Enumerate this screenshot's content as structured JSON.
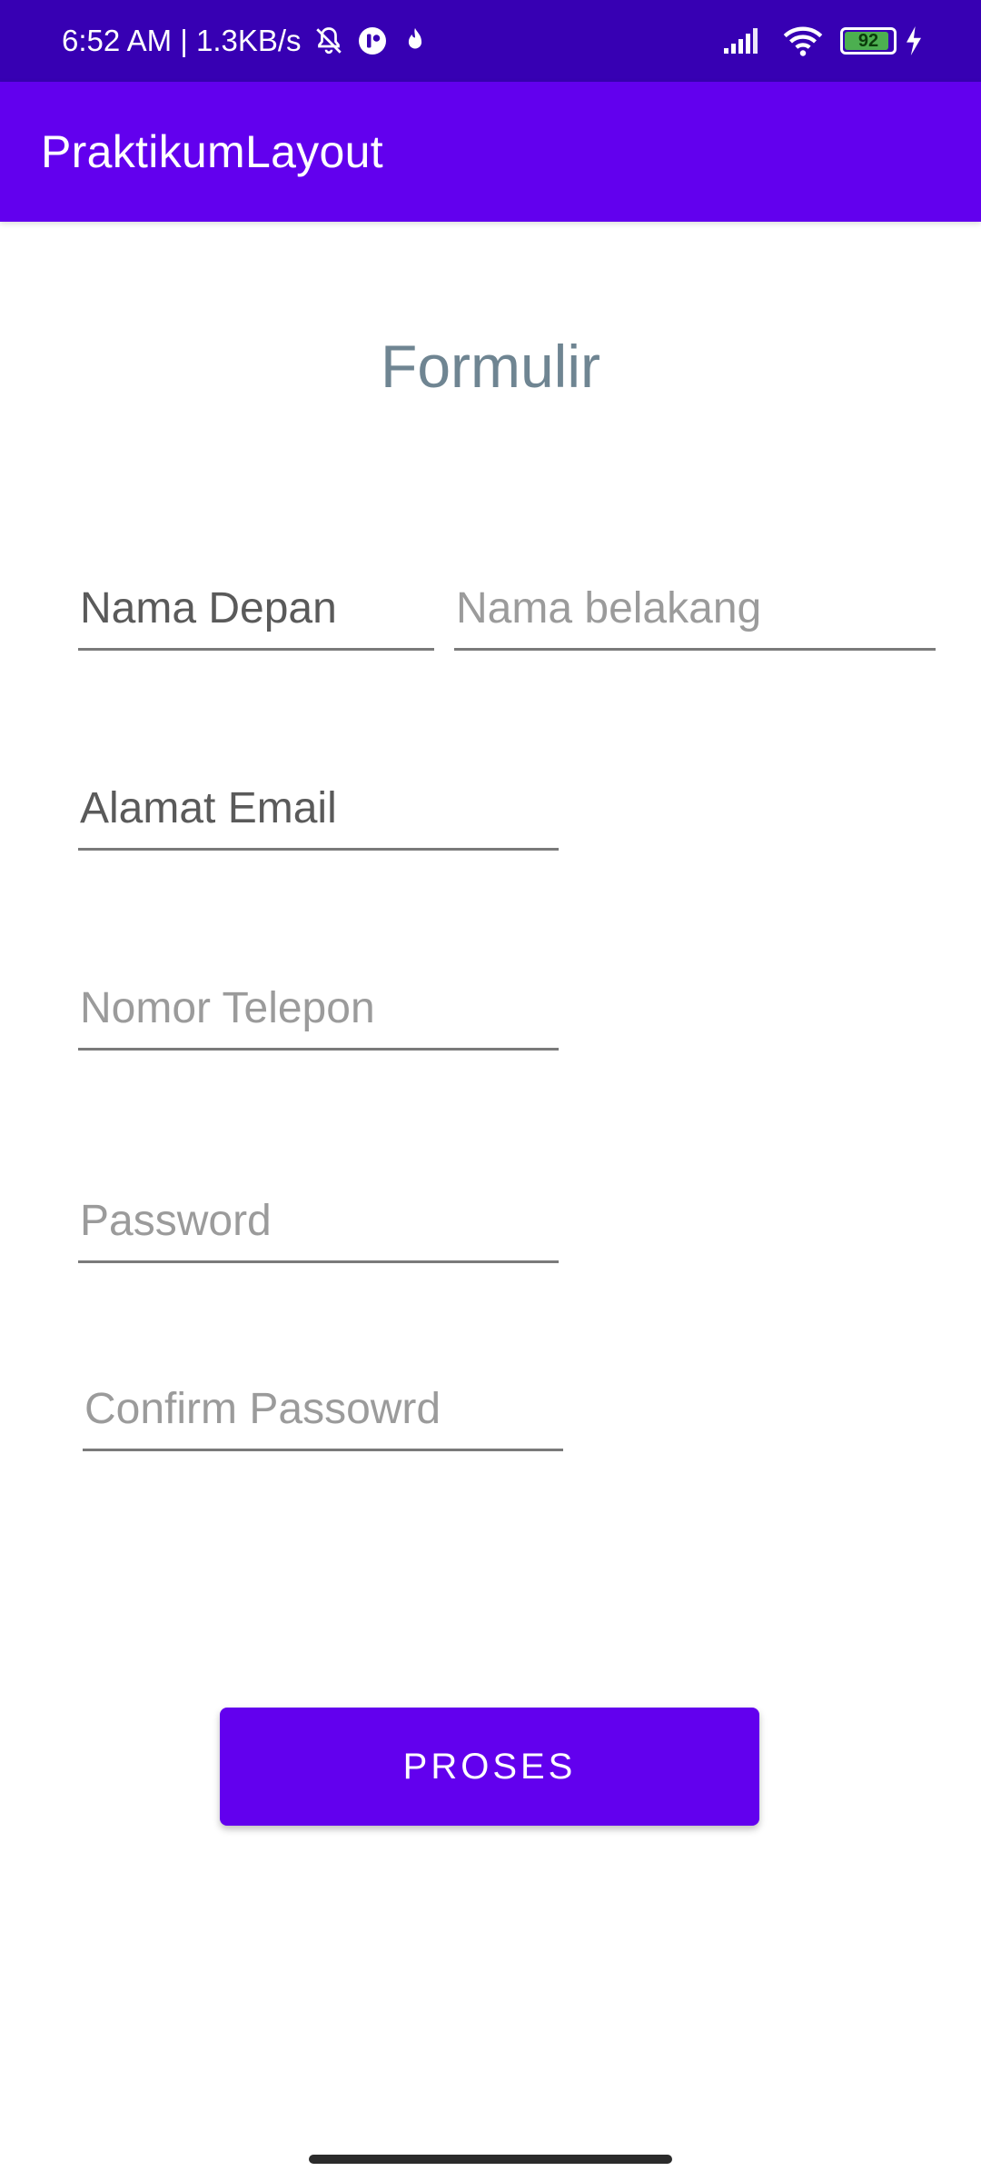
{
  "status_bar": {
    "time_and_speed": "6:52 AM | 1.3KB/s",
    "battery_level": "92",
    "battery_fraction": 0.92,
    "icons": [
      "bell-off-icon",
      "app-notification-icon",
      "flame-icon",
      "signal-icon",
      "wifi-icon",
      "battery-icon",
      "charging-icon"
    ]
  },
  "app_bar": {
    "title": "PraktikumLayout"
  },
  "form": {
    "heading": "Formulir",
    "first_name": {
      "value": "Nama Depan",
      "placeholder": ""
    },
    "last_name": {
      "value": "",
      "placeholder": "Nama belakang"
    },
    "email": {
      "value": "Alamat Email",
      "placeholder": ""
    },
    "phone": {
      "value": "",
      "placeholder": "Nomor Telepon"
    },
    "password": {
      "value": "",
      "placeholder": "Password"
    },
    "confirm_password": {
      "value": "",
      "placeholder": "Confirm Passowrd"
    },
    "submit_label": "PROSES"
  },
  "colors": {
    "status_bar": "#3700B3",
    "app_bar": "#6200EE",
    "button": "#6200EE",
    "heading": "#6f8592"
  }
}
